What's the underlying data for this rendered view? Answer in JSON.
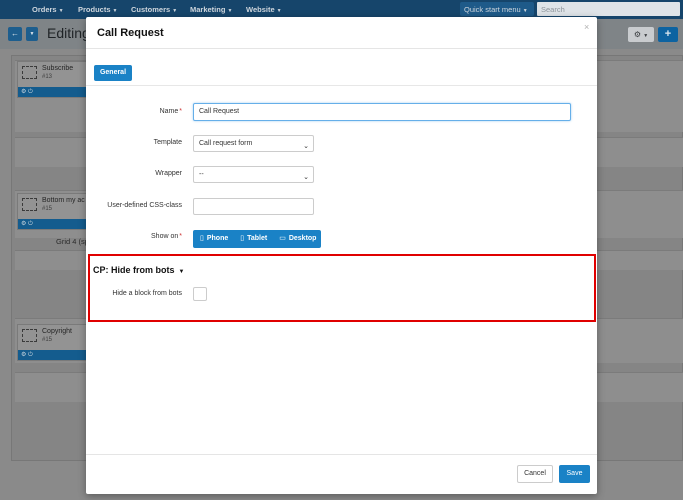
{
  "topnav": {
    "items": [
      {
        "label": "Orders"
      },
      {
        "label": "Products"
      },
      {
        "label": "Customers"
      },
      {
        "label": "Marketing"
      },
      {
        "label": "Website"
      }
    ],
    "quick_start": "Quick start menu",
    "search_placeholder": "Search"
  },
  "subbar": {
    "title": "Editing"
  },
  "background_blocks": [
    {
      "title": "Subscribe",
      "id": "#13"
    },
    {
      "title": "Bottom my ac",
      "id": "#15"
    },
    {
      "title": "Copyright",
      "id": "#15"
    }
  ],
  "grid_label": "Grid 4 (sp",
  "modal": {
    "title": "Call Request",
    "close": "×",
    "tab": "General",
    "fields": {
      "name_label": "Name",
      "name_value": "Call Request",
      "template_label": "Template",
      "template_value": "Call request form",
      "wrapper_label": "Wrapper",
      "wrapper_value": "--",
      "css_label": "User-defined CSS-class",
      "css_value": "",
      "showon_label": "Show on",
      "showon_options": [
        {
          "label": "Phone",
          "icon": "phone-icon"
        },
        {
          "label": "Tablet",
          "icon": "tablet-icon"
        },
        {
          "label": "Desktop",
          "icon": "desktop-icon"
        }
      ]
    },
    "cp_section": {
      "title": "CP: Hide from bots",
      "hide_label": "Hide a block from bots",
      "hide_checked": false
    },
    "cancel": "Cancel",
    "save": "Save"
  },
  "colors": {
    "accent": "#1a82c6",
    "highlight": "#e00000",
    "topbar": "#16456b"
  }
}
